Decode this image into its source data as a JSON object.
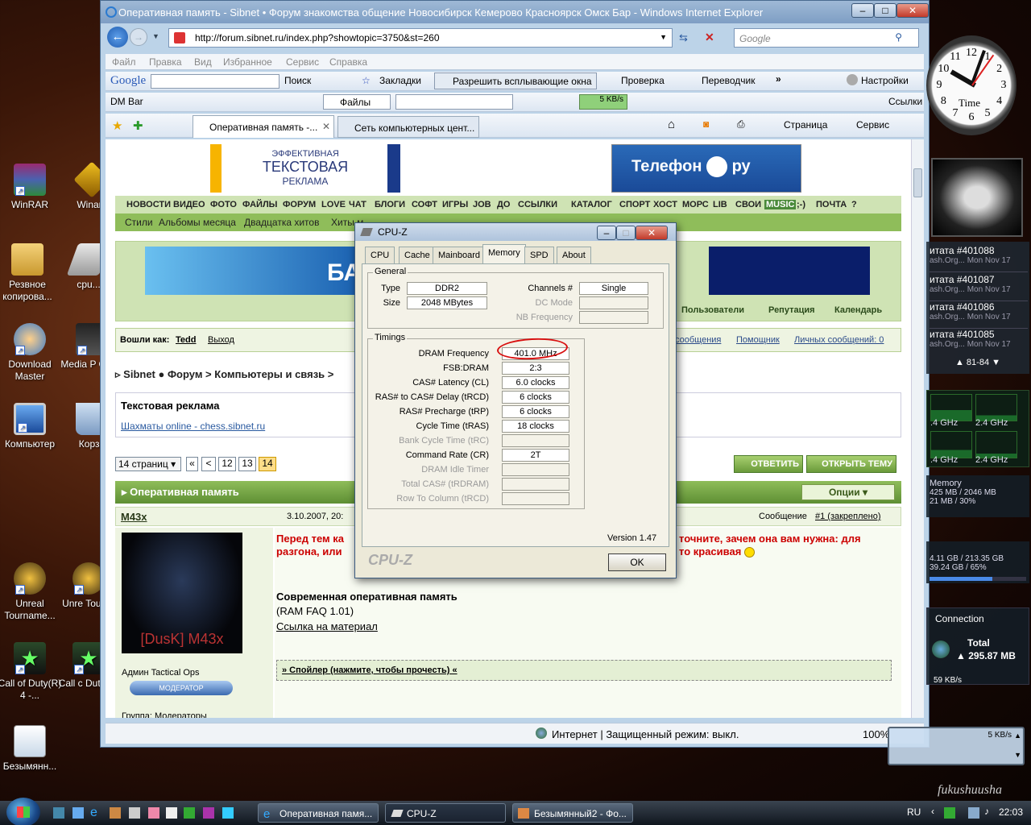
{
  "desktop": {
    "icons": [
      {
        "label": "WinRAR"
      },
      {
        "label": "Winam"
      },
      {
        "label": "Резвное копирова..."
      },
      {
        "label": "cpu..."
      },
      {
        "label": "Download Master"
      },
      {
        "label": "Media P Class"
      },
      {
        "label": "Компьютер"
      },
      {
        "label": "Корзи"
      },
      {
        "label": "Unreal Tourname..."
      },
      {
        "label": "Unre Tourna"
      },
      {
        "label": "Call of Duty(R) 4 -..."
      },
      {
        "label": "Call c Duty(R)"
      },
      {
        "label": "Безымянн..."
      }
    ],
    "watermark": "fukushuusha"
  },
  "browser": {
    "title": "Оперативная память - Sibnet • Форум знакомства общение Новосибирск Кемерово Красноярск Омск Бар - Windows Internet Explorer",
    "url": "http://forum.sibnet.ru/index.php?showtopic=3750&st=260",
    "search_placeholder": "Google",
    "menu": [
      "Файл",
      "Правка",
      "Вид",
      "Избранное",
      "Сервис",
      "Справка"
    ],
    "google_bar": {
      "brand": "Google",
      "search": "Поиск",
      "bookmarks": "Закладки",
      "popups": "Разрешить всплывающие окна",
      "check": "Проверка",
      "translate": "Переводчик",
      "settings": "Настройки"
    },
    "dm_bar": {
      "label": "DM Bar",
      "files": "Файлы",
      "speed": "5 KB/s",
      "links": "Ссылки"
    },
    "tabs": [
      {
        "label": "Оперативная память -..."
      },
      {
        "label": "Сеть компьютерных цент..."
      }
    ],
    "cmd": {
      "page": "Страница",
      "service": "Сервис"
    },
    "status": {
      "zone": "Интернет | Защищенный режим: выкл.",
      "zoom": "100%"
    }
  },
  "forum": {
    "ad_left": {
      "line1": "ЭФФЕКТИВНАЯ",
      "line2": "ТЕКСТОВАЯ",
      "line3": "РЕКЛАМА"
    },
    "ad_right": {
      "text": "Телефон",
      "suffix": "ру"
    },
    "nav": [
      "НОВОСТИ",
      "ВИДЕО",
      "ФОТО",
      "ФАЙЛЫ",
      "ФОРУМ",
      "LOVE",
      "ЧАТ",
      "БЛОГИ",
      "СОФТ",
      "ИГРЫ",
      "JOB",
      "ДО",
      "ССЫЛКИ",
      "КАТАЛОГ",
      "СПОРТ",
      "ХОСТ",
      "МОРС",
      "LIB",
      "СВОИ",
      "MUSIC",
      ";-)",
      "ПОЧТА",
      "?"
    ],
    "subnav": [
      "Стили",
      "Альбомы месяца",
      "Двадцатка хитов",
      "Хиты м"
    ],
    "banner_text": "БА",
    "user_links": {
      "users": "Пользователи",
      "reputation": "Репутация",
      "calendar": "Календарь"
    },
    "login": {
      "prefix": "Вошли как:",
      "user": "Tedd",
      "logout": "Выход"
    },
    "right_links": {
      "messages": "сообщения",
      "helper": "Помощник",
      "pm": "Личных сообщений: 0"
    },
    "breadcrumb": {
      "site": "Sibnet ● Форум",
      "section": "Компьютеры и связь"
    },
    "text_ad": {
      "title": "Текстовая реклама",
      "link": "Шахматы online - chess.sibnet.ru"
    },
    "pages": {
      "select": "14 страниц",
      "first": "«",
      "prev": "<",
      "p12": "12",
      "p13": "13",
      "p14": "14"
    },
    "reply_btn": "ОТВЕТИТЬ",
    "new_topic_btn": "ОТКРЫТЬ ТЕМУ",
    "topic_title": "Оперативная память",
    "options": "Опции",
    "post": {
      "author": "M43x",
      "date": "3.10.2007, 20:",
      "msg_label": "Сообщение",
      "msg_link": "#1 (закреплено)",
      "red_line1_a": "Перед тем ка",
      "red_line1_b": "точните, зачем она вам нужна: для",
      "red_line2_a": "разгона, или",
      "red_line2_b": "то красивая",
      "heading": "Современная оперативная память",
      "faq": "(RAM FAQ 1.01)",
      "link": "Ссылка на материал",
      "spoiler": "» Спойлер (нажмите, чтобы прочесть) «",
      "avatar_text": "[DusK] M43x",
      "role": "Админ Tactical Ops",
      "badge": "МОДЕРАТОР",
      "group": "Группа: Модераторы"
    }
  },
  "cpuz": {
    "title": "CPU-Z",
    "tabs": [
      "CPU",
      "Cache",
      "Mainboard",
      "Memory",
      "SPD",
      "About"
    ],
    "active_tab": "Memory",
    "general": {
      "group": "General",
      "type_label": "Type",
      "type": "DDR2",
      "size_label": "Size",
      "size": "2048 MBytes",
      "channels_label": "Channels #",
      "channels": "Single",
      "dc_label": "DC Mode",
      "nb_label": "NB Frequency"
    },
    "timings": {
      "group": "Timings",
      "rows": [
        {
          "label": "DRAM Frequency",
          "value": "401.0 MHz",
          "enabled": true
        },
        {
          "label": "FSB:DRAM",
          "value": "2:3",
          "enabled": true
        },
        {
          "label": "CAS# Latency (CL)",
          "value": "6.0 clocks",
          "enabled": true
        },
        {
          "label": "RAS# to CAS# Delay (tRCD)",
          "value": "6 clocks",
          "enabled": true
        },
        {
          "label": "RAS# Precharge (tRP)",
          "value": "6 clocks",
          "enabled": true
        },
        {
          "label": "Cycle Time (tRAS)",
          "value": "18 clocks",
          "enabled": true
        },
        {
          "label": "Bank Cycle Time (tRC)",
          "value": "",
          "enabled": false
        },
        {
          "label": "Command Rate (CR)",
          "value": "2T",
          "enabled": true
        },
        {
          "label": "DRAM Idle Timer",
          "value": "",
          "enabled": false
        },
        {
          "label": "Total CAS# (tRDRAM)",
          "value": "",
          "enabled": false
        },
        {
          "label": "Row To Column (tRCD)",
          "value": "",
          "enabled": false
        }
      ]
    },
    "version": "Version 1.47",
    "brand": "CPU-Z",
    "ok": "OK"
  },
  "sidebar": {
    "clock_label": "Time",
    "clock_numbers": [
      "12",
      "1",
      "2",
      "3",
      "4",
      "5",
      "6",
      "7",
      "8",
      "9",
      "10",
      "11"
    ],
    "feeds": [
      {
        "title": "итата #401088",
        "src": "ash.Org...",
        "date": "Mon Nov 17"
      },
      {
        "title": "итата #401087",
        "src": "ash.Org...",
        "date": "Mon Nov 17"
      },
      {
        "title": "итата #401086",
        "src": "ash.Org...",
        "date": "Mon Nov 17"
      },
      {
        "title": "итата #401085",
        "src": "ash.Org...",
        "date": "Mon Nov 17"
      }
    ],
    "feed_pager": "81-84",
    "cpu": [
      ".4 GHz",
      "2.4 GHz",
      ".4 GHz",
      "2.4 GHz"
    ],
    "memory": {
      "title": "Memory",
      "line1": "425 MB / 2046 MB",
      "line2": "21 MB / 30%"
    },
    "drive": {
      "line1": "4.11 GB / 213.35 GB",
      "line2": "39.24 GB / 65%"
    },
    "net": {
      "title": "Connection",
      "total_label": "Total",
      "total": "295.87 MB",
      "rate": "59 KB/s"
    },
    "mini": {
      "rate": "5 KB/s"
    }
  },
  "taskbar": {
    "items": [
      {
        "label": "Оперативная памя..."
      },
      {
        "label": "CPU-Z"
      },
      {
        "label": "Безымянный2 - Фо..."
      }
    ],
    "lang": "RU",
    "time": "22:03"
  }
}
